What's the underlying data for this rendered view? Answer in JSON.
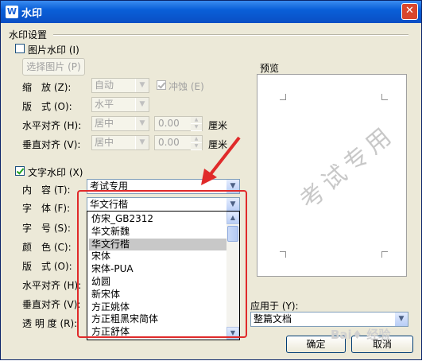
{
  "window": {
    "title": "水印",
    "app_icon": "W",
    "close_icon": "close-icon"
  },
  "group_title": "水印设置",
  "picture": {
    "checkbox_label": "图片水印",
    "checkbox_key": "(I)",
    "checked": false,
    "choose_button": "选择图片",
    "choose_key": "(P)",
    "scale_label": "缩　放",
    "scale_key": "(Z):",
    "scale_value": "自动",
    "washout_label": "冲蚀",
    "washout_key": "(E)",
    "layout_label": "版　式",
    "layout_key": "(O):",
    "layout_value": "水平",
    "halign_label": "水平对齐",
    "halign_key": "(H):",
    "halign_value": "居中",
    "halign_num": "0.00",
    "valign_label": "垂直对齐",
    "valign_key": "(V):",
    "valign_value": "居中",
    "valign_num": "0.00",
    "unit": "厘米"
  },
  "text": {
    "checkbox_label": "文字水印",
    "checkbox_key": "(X)",
    "checked": true,
    "content_label": "内　容",
    "content_key": "(T):",
    "content_value": "考试专用",
    "font_label": "字　体",
    "font_key": "(F):",
    "font_value": "华文行楷",
    "size_label": "字　号",
    "size_key": "(S):",
    "color_label": "颜　色",
    "color_key": "(C):",
    "layout_label": "版　式",
    "layout_key": "(O):",
    "halign_label": "水平对齐",
    "halign_key": "(H):",
    "valign_label": "垂直对齐",
    "valign_key": "(V):",
    "opacity_label": "透 明 度",
    "opacity_key": "(R):"
  },
  "font_list": [
    "仿宋_GB2312",
    "华文新魏",
    "华文行楷",
    "宋体",
    "宋体-PUA",
    "幼圆",
    "新宋体",
    "方正姚体",
    "方正粗黑宋简体",
    "方正舒体"
  ],
  "font_list_selected": "华文行楷",
  "preview": {
    "label": "预览",
    "watermark_text": "考试专用"
  },
  "apply": {
    "label": "应用于",
    "key": "(Y):",
    "value": "整篇文档"
  },
  "buttons": {
    "ok": "确定",
    "cancel": "取消"
  },
  "overlay": {
    "brand": "Bai♦ 经验"
  },
  "colors": {
    "titlebar": "#0a5fd8",
    "dialog_bg": "#ece9d8",
    "annotation_red": "#e02a2a"
  }
}
